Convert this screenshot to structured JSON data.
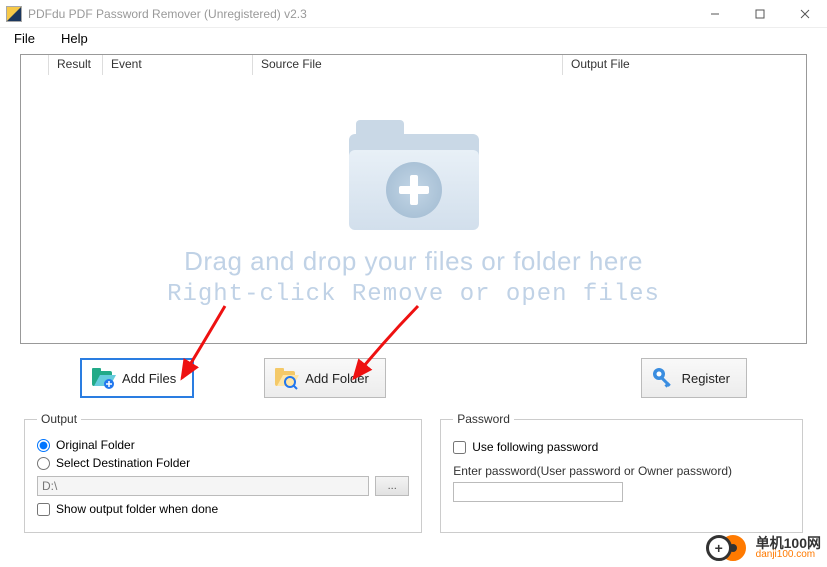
{
  "window": {
    "title": "PDFdu  PDF  Password  Remover (Unregistered) v2.3"
  },
  "menu": {
    "file": "File",
    "help": "Help"
  },
  "table": {
    "col_result": "Result",
    "col_event": "Event",
    "col_source": "Source File",
    "col_output": "Output File"
  },
  "drop": {
    "line1": "Drag and drop your files or folder here",
    "line2": "Right-click Remove or open files"
  },
  "buttons": {
    "add_files": "Add Files",
    "add_folder": "Add Folder",
    "register": "Register"
  },
  "output": {
    "legend": "Output",
    "original": "Original Folder",
    "select_dest": "Select Destination Folder",
    "path": "D:\\",
    "browse": "...",
    "show_when_done": "Show output folder when done"
  },
  "password": {
    "legend": "Password",
    "use_following": "Use following password",
    "enter_label": "Enter password(User password or Owner password)"
  },
  "watermark": {
    "name": "单机100网",
    "url": "danji100.com"
  }
}
